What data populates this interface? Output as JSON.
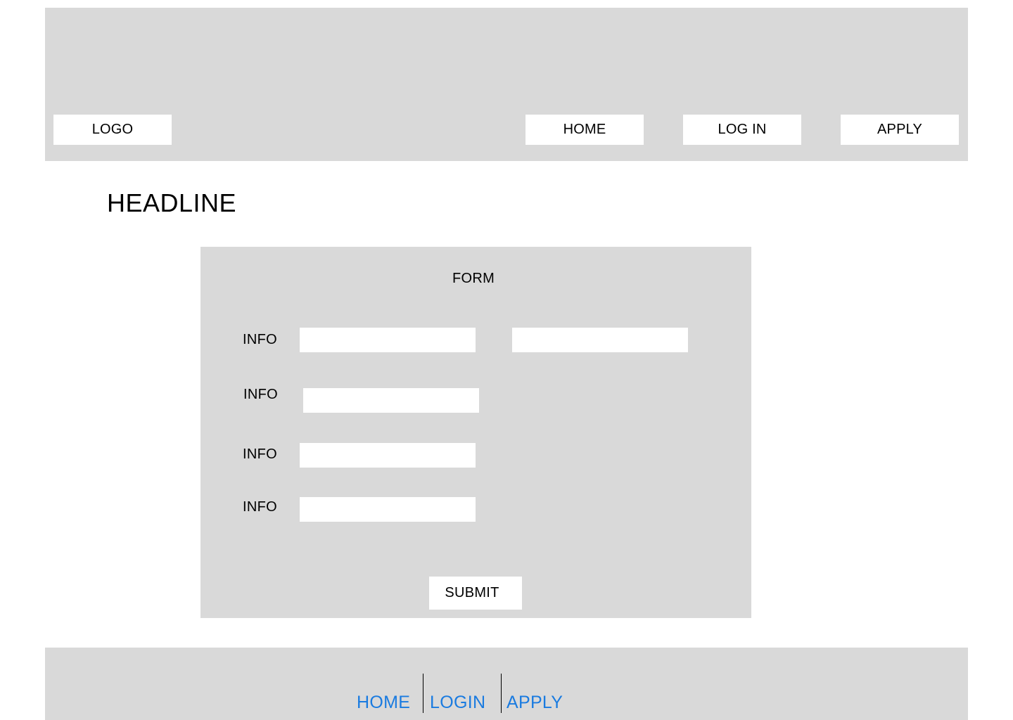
{
  "header": {
    "logo_label": "LOGO",
    "nav": {
      "home": "HOME",
      "login": "LOG IN",
      "apply": "APPLY"
    }
  },
  "headline": "HEADLINE",
  "form": {
    "title": "FORM",
    "rows": [
      {
        "label": "INFO",
        "value": "",
        "placeholder": ""
      },
      {
        "label": "INFO",
        "value": "",
        "placeholder": ""
      },
      {
        "label": "INFO",
        "value": "",
        "placeholder": ""
      },
      {
        "label": "INFO",
        "value": "",
        "placeholder": ""
      }
    ],
    "extra_field": {
      "value": "",
      "placeholder": ""
    },
    "submit_label": "SUBMIT"
  },
  "footer": {
    "links": {
      "home": "HOME",
      "login": "LOGIN",
      "apply": "APPLY"
    }
  },
  "colors": {
    "panel": "#d9d9d9",
    "link": "#1a7be0"
  }
}
